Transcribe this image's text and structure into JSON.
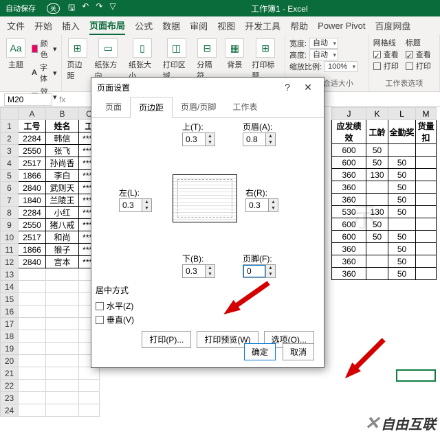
{
  "titlebar": {
    "autosave": "自动保存",
    "off": "关",
    "doc": "工作簿1 - Excel"
  },
  "menu": [
    "文件",
    "开始",
    "插入",
    "页面布局",
    "公式",
    "数据",
    "审阅",
    "视图",
    "开发工具",
    "帮助",
    "Power Pivot",
    "百度网盘"
  ],
  "menu_active": 3,
  "ribbon": {
    "themes": {
      "label": "主题",
      "color": "颜色",
      "font": "字体",
      "effect": "效果"
    },
    "pagegrp": [
      "页边距",
      "纸张方向",
      "纸张大小",
      "打印区域",
      "分隔符",
      "背景",
      "打印标题"
    ],
    "size": {
      "width": "宽度:",
      "height": "高度:",
      "scale": "缩放比例:",
      "auto": "自动",
      "pct": "100%",
      "grplabel": "调整为合适大小"
    },
    "gridview": {
      "grid": "网格线",
      "title": "标题",
      "view": "查看",
      "print": "打印",
      "grplabel": "工作表选项"
    }
  },
  "namebox": "M20",
  "colheads": [
    "A",
    "B",
    "C"
  ],
  "colheads2": [
    "J",
    "K",
    "L",
    "M"
  ],
  "headers": {
    "a": "工号",
    "b": "姓名",
    "c": "工",
    "j": "应发绩效",
    "k": "工龄",
    "l": "全勤奖",
    "m": "货量扣"
  },
  "rows": [
    {
      "a": "2284",
      "b": "韩信",
      "j": "600",
      "k": "50",
      "l": ""
    },
    {
      "a": "2550",
      "b": "张飞",
      "j": "600",
      "k": "50",
      "l": "50"
    },
    {
      "a": "2517",
      "b": "孙尚香",
      "j": "360",
      "k": "130",
      "l": "50"
    },
    {
      "a": "1866",
      "b": "李白",
      "j": "360",
      "k": "",
      "l": "50"
    },
    {
      "a": "2840",
      "b": "武则天",
      "j": "360",
      "k": "",
      "l": "50"
    },
    {
      "a": "1840",
      "b": "兰陵王",
      "j": "530",
      "k": "130",
      "l": "50"
    },
    {
      "a": "2284",
      "b": "小红",
      "j": "600",
      "k": "50",
      "l": ""
    },
    {
      "a": "2550",
      "b": "猪八戒",
      "j": "600",
      "k": "50",
      "l": "50"
    },
    {
      "a": "2517",
      "b": "和尚",
      "j": "360",
      "k": "",
      "l": "50"
    },
    {
      "a": "1866",
      "b": "猴子",
      "j": "360",
      "k": "",
      "l": "50"
    },
    {
      "a": "2840",
      "b": "宫本",
      "j": "360",
      "k": "",
      "l": "50"
    }
  ],
  "mask": "****",
  "dialog": {
    "title": "页面设置",
    "tabs": [
      "页面",
      "页边距",
      "页眉/页脚",
      "工作表"
    ],
    "tab_active": 1,
    "labels": {
      "top": "上(T):",
      "header": "页眉(A):",
      "left": "左(L):",
      "right": "右(R):",
      "bottom": "下(B):",
      "footer": "页脚(F):"
    },
    "vals": {
      "top": "0.3",
      "header": "0.8",
      "left": "0.3",
      "right": "0.3",
      "bottom": "0.3",
      "footer": "0"
    },
    "center": {
      "title": "居中方式",
      "h": "水平(Z)",
      "v": "垂直(V)"
    },
    "btns": {
      "print": "打印(P)...",
      "preview": "打印预览(W)",
      "options": "选项(O)...",
      "ok": "确定",
      "cancel": "取消"
    }
  },
  "watermark": "自由互联"
}
